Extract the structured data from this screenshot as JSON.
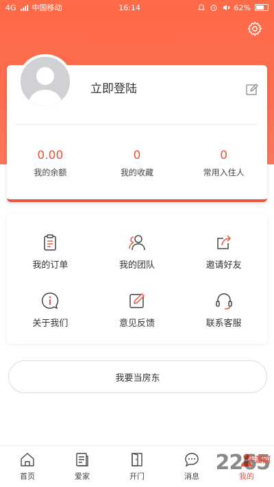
{
  "status_bar": {
    "carrier": "中国移动",
    "network": "4G",
    "time": "16:14",
    "battery": "62%"
  },
  "profile": {
    "login_label": "立即登陆",
    "stats": [
      {
        "value": "0.00",
        "label": "我的余额"
      },
      {
        "value": "0",
        "label": "我的收藏"
      },
      {
        "value": "0",
        "label": "常用入住人"
      }
    ]
  },
  "menu": {
    "items": [
      {
        "label": "我的订单",
        "icon": "clipboard-icon"
      },
      {
        "label": "我的团队",
        "icon": "team-icon"
      },
      {
        "label": "邀请好友",
        "icon": "share-icon"
      },
      {
        "label": "关于我们",
        "icon": "info-icon"
      },
      {
        "label": "意见反馈",
        "icon": "feedback-icon"
      },
      {
        "label": "联系客服",
        "icon": "headset-icon"
      }
    ]
  },
  "landlord_button": "我要当房东",
  "bottom_nav": {
    "items": [
      {
        "label": "首页",
        "icon": "home-icon"
      },
      {
        "label": "爱家",
        "icon": "document-icon"
      },
      {
        "label": "开门",
        "icon": "door-icon"
      },
      {
        "label": "消息",
        "icon": "chat-icon"
      },
      {
        "label": "我的",
        "icon": "user-icon",
        "active": true
      }
    ]
  },
  "watermark": {
    "text": "2265",
    "sub": "手游网"
  },
  "colors": {
    "accent": "#e8553c",
    "header": "#fb6e4f"
  }
}
